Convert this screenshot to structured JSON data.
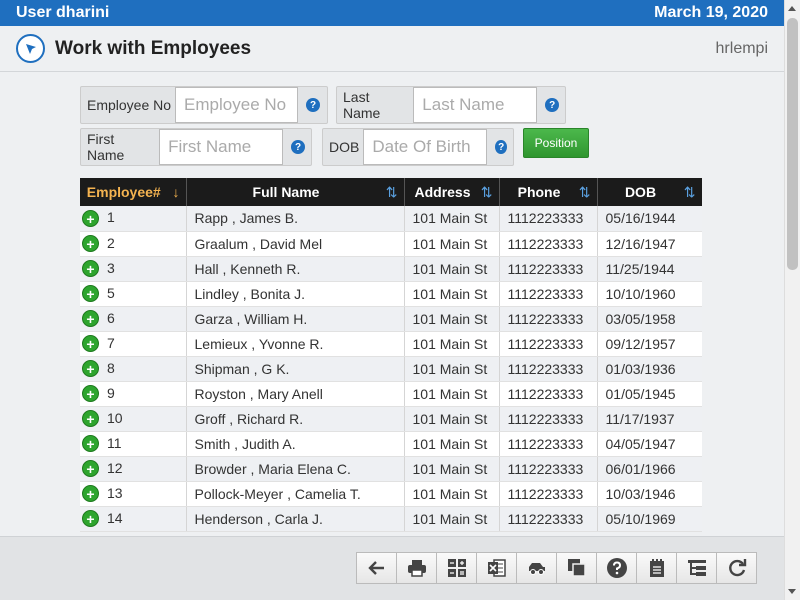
{
  "header": {
    "user": "User dharini",
    "date": "March 19, 2020"
  },
  "page": {
    "title": "Work with Employees",
    "program": "hrlempi"
  },
  "filters": {
    "employee_no": {
      "label": "Employee No",
      "placeholder": "Employee No",
      "value": ""
    },
    "last_name": {
      "label": "Last Name",
      "placeholder": "Last Name",
      "value": ""
    },
    "first_name": {
      "label": "First Name",
      "placeholder": "First Name",
      "value": ""
    },
    "dob": {
      "label": "DOB",
      "placeholder": "Date Of Birth",
      "value": ""
    },
    "help_glyph": "?",
    "position_label": "Position"
  },
  "grid": {
    "columns": [
      "Employee#",
      "Full Name",
      "Address",
      "Phone",
      "DOB"
    ],
    "sorted_column": "Employee#",
    "rows": [
      {
        "id": "1",
        "name": "Rapp , James B.",
        "address": "101 Main St",
        "phone": "1112223333",
        "dob": "05/16/1944"
      },
      {
        "id": "2",
        "name": "Graalum , David Mel",
        "address": "101 Main St",
        "phone": "1112223333",
        "dob": "12/16/1947"
      },
      {
        "id": "3",
        "name": "Hall , Kenneth R.",
        "address": "101 Main St",
        "phone": "1112223333",
        "dob": "11/25/1944"
      },
      {
        "id": "5",
        "name": "Lindley , Bonita J.",
        "address": "101 Main St",
        "phone": "1112223333",
        "dob": "10/10/1960"
      },
      {
        "id": "6",
        "name": "Garza , William H.",
        "address": "101 Main St",
        "phone": "1112223333",
        "dob": "03/05/1958"
      },
      {
        "id": "7",
        "name": "Lemieux , Yvonne R.",
        "address": "101 Main St",
        "phone": "1112223333",
        "dob": "09/12/1957"
      },
      {
        "id": "8",
        "name": "Shipman , G K.",
        "address": "101 Main St",
        "phone": "1112223333",
        "dob": "01/03/1936"
      },
      {
        "id": "9",
        "name": "Royston , Mary Anell",
        "address": "101 Main St",
        "phone": "1112223333",
        "dob": "01/05/1945"
      },
      {
        "id": "10",
        "name": "Groff , Richard R.",
        "address": "101 Main St",
        "phone": "1112223333",
        "dob": "11/17/1937"
      },
      {
        "id": "11",
        "name": "Smith , Judith A.",
        "address": "101 Main St",
        "phone": "1112223333",
        "dob": "04/05/1947"
      },
      {
        "id": "12",
        "name": "Browder , Maria Elena C.",
        "address": "101 Main St",
        "phone": "1112223333",
        "dob": "06/01/1966"
      },
      {
        "id": "13",
        "name": "Pollock-Meyer , Camelia T.",
        "address": "101 Main St",
        "phone": "1112223333",
        "dob": "10/03/1946"
      },
      {
        "id": "14",
        "name": "Henderson , Carla J.",
        "address": "101 Main St",
        "phone": "1112223333",
        "dob": "05/10/1969"
      }
    ]
  },
  "toolbar": {
    "icons": [
      "back-arrow-icon",
      "print-icon",
      "calculator-icon",
      "excel-icon",
      "car-icon",
      "copy-icon",
      "help-icon",
      "notepad-icon",
      "tree-icon",
      "refresh-icon"
    ]
  },
  "colors": {
    "header_blue": "#1f6fbf",
    "grid_header": "#1b1b1b",
    "active_sort": "#f4b350",
    "action_green": "#2ea52e"
  }
}
